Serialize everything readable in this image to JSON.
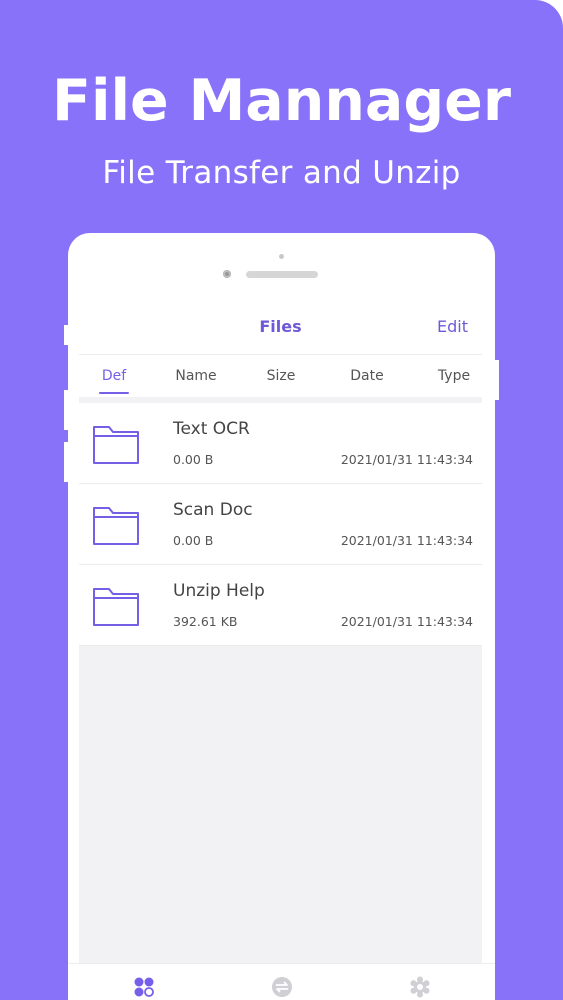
{
  "banner": {
    "headline": "File Mannager",
    "subheadline": "File Transfer and Unzip"
  },
  "colors": {
    "background": "#8872f9",
    "accent": "#7560ea",
    "folder_stroke": "#7460e6"
  },
  "navbar": {
    "title": "Files",
    "edit_label": "Edit"
  },
  "sort_tabs": [
    {
      "label": "Def",
      "active": true
    },
    {
      "label": "Name",
      "active": false
    },
    {
      "label": "Size",
      "active": false
    },
    {
      "label": "Date",
      "active": false
    },
    {
      "label": "Type",
      "active": false
    }
  ],
  "files": [
    {
      "name": "Text OCR",
      "size": "0.00 B",
      "date": "2021/01/31 11:43:34",
      "icon": "folder-icon"
    },
    {
      "name": "Scan Doc",
      "size": "0.00 B",
      "date": "2021/01/31 11:43:34",
      "icon": "folder-icon"
    },
    {
      "name": "Unzip Help",
      "size": "392.61 KB",
      "date": "2021/01/31 11:43:34",
      "icon": "folder-icon"
    }
  ],
  "fab": {
    "icon": "plus-icon"
  },
  "tabbar": [
    {
      "icon": "files-grid-icon",
      "active": true
    },
    {
      "icon": "transfer-icon",
      "active": false
    },
    {
      "icon": "settings-gear-icon",
      "active": false
    }
  ]
}
